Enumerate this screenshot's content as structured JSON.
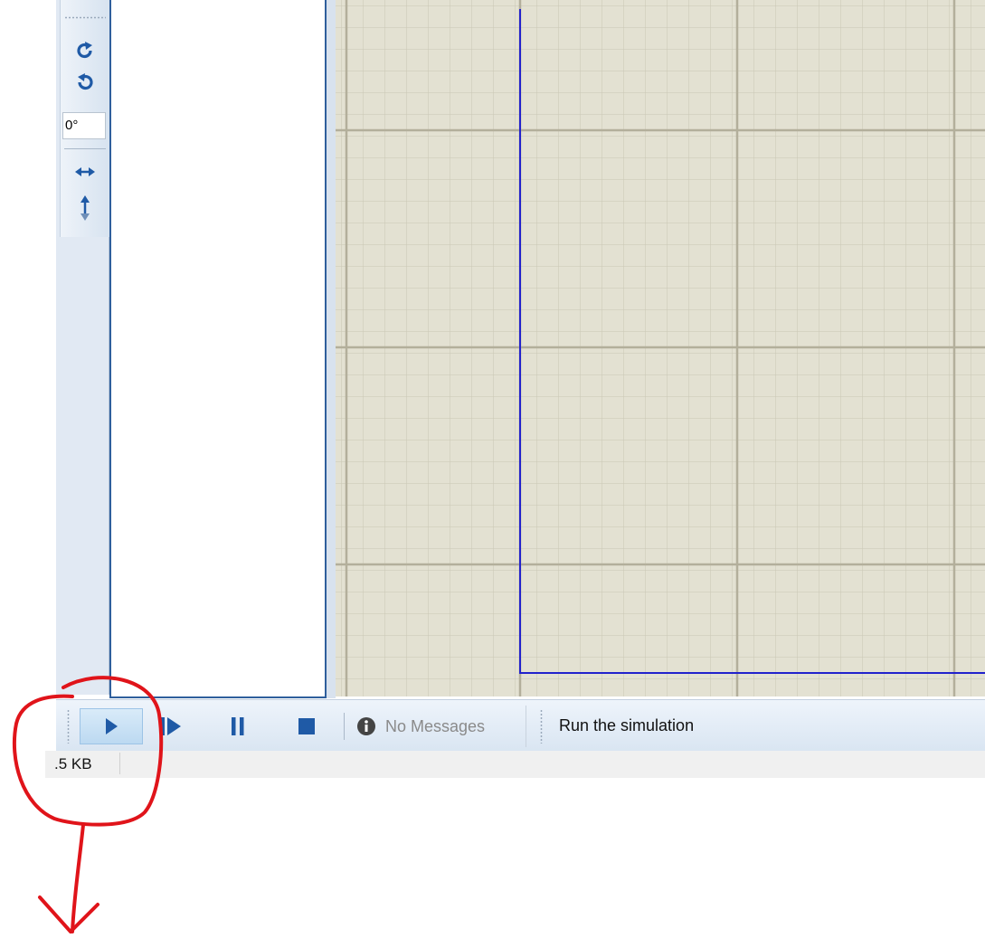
{
  "toolbar": {
    "rotate_cw_icon": "rotate-clockwise-icon",
    "rotate_ccw_icon": "rotate-counterclockwise-icon",
    "angle_value": "0°",
    "mirror_x_icon": "mirror-horizontal-icon",
    "mirror_y_icon": "mirror-vertical-icon"
  },
  "simulation": {
    "play_icon": "play-icon",
    "step_icon": "step-icon",
    "pause_icon": "pause-icon",
    "stop_icon": "stop-icon",
    "messages_icon": "info-icon",
    "messages": "No Messages",
    "status": "Run the simulation"
  },
  "status_bar": {
    "file_size": ".5 KB"
  },
  "colors": {
    "accent_blue": "#1f5aa6",
    "canvas_bg": "#e3e1d2",
    "grid_line": "#c8c4b2",
    "sheet_border": "#2222cc",
    "annotation": "#e0141a"
  }
}
